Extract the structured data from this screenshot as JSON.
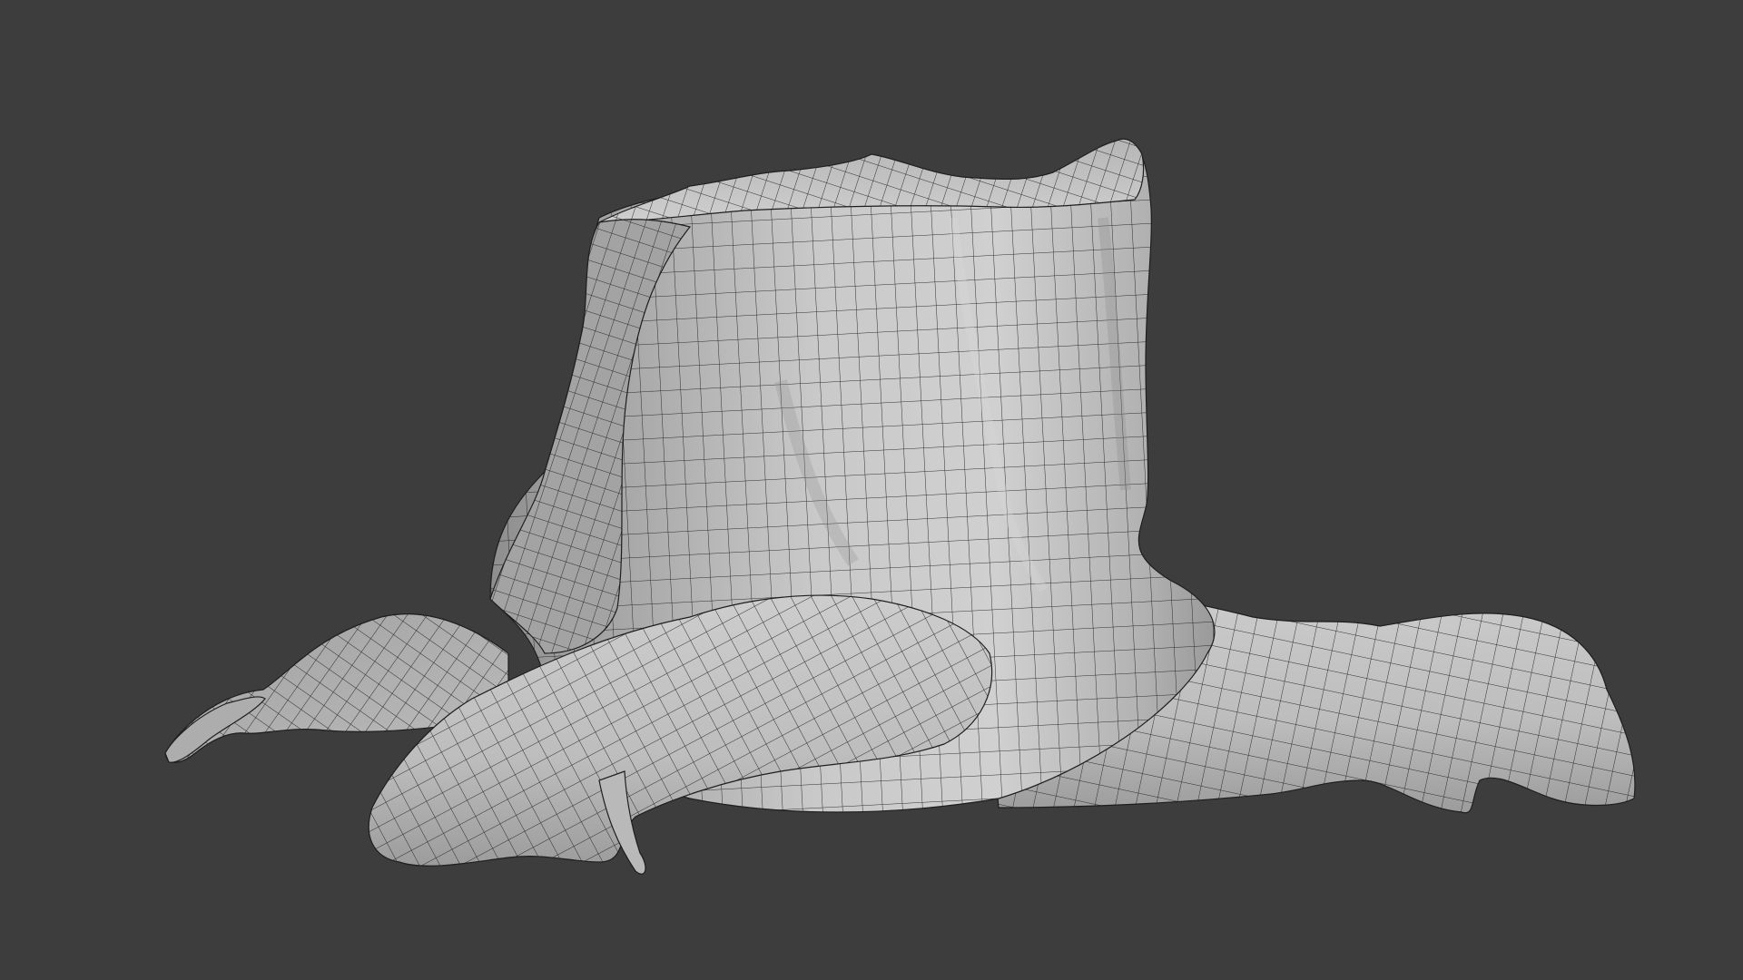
{
  "viewport": {
    "shading": "solid",
    "overlay": "wireframe",
    "object": "tree-stump-icon"
  },
  "colors": {
    "background": "#3d3d3d",
    "mesh_light": "#c8c8c8",
    "mesh_mid": "#a9a9a9",
    "mesh_dark": "#7e7e7e",
    "wire": "#1e1e1e"
  }
}
